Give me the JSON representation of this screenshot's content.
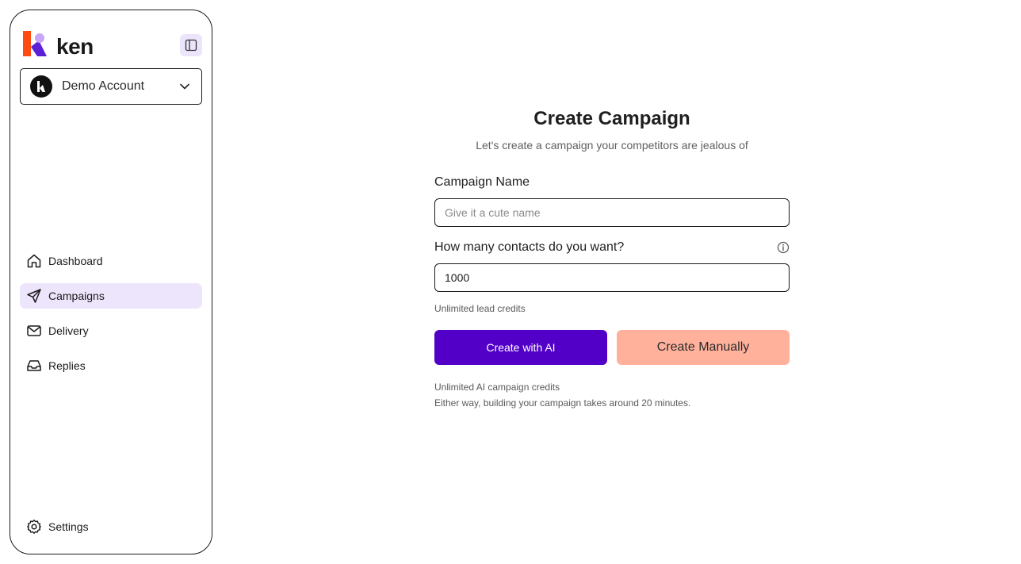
{
  "brand": {
    "name": "ken",
    "logo_icon": "ken-logo-icon"
  },
  "sidebar": {
    "collapse_icon": "sidebar-toggle-icon",
    "account": {
      "name": "Demo Account",
      "avatar_icon": "ken-avatar-icon",
      "chevron_icon": "chevron-down-icon"
    },
    "nav": [
      {
        "label": "Dashboard",
        "icon": "home-icon",
        "active": false
      },
      {
        "label": "Campaigns",
        "icon": "send-icon",
        "active": true
      },
      {
        "label": "Delivery",
        "icon": "mail-icon",
        "active": false
      },
      {
        "label": "Replies",
        "icon": "inbox-icon",
        "active": false
      }
    ],
    "settings": {
      "label": "Settings",
      "icon": "gear-icon"
    }
  },
  "main": {
    "title": "Create Campaign",
    "subtitle": "Let's create a campaign your competitors are jealous of",
    "campaign_name": {
      "label": "Campaign Name",
      "placeholder": "Give it a cute name",
      "value": ""
    },
    "contacts": {
      "label": "How many contacts do you want?",
      "value": "1000",
      "info_icon": "info-icon"
    },
    "lead_credits_hint": "Unlimited lead credits",
    "buttons": {
      "ai": "Create with AI",
      "manual": "Create Manually"
    },
    "footnote_1": "Unlimited AI campaign credits",
    "footnote_2": "Either way, building your campaign takes around 20 minutes."
  },
  "colors": {
    "accent": "#5200c8",
    "active_nav_bg": "#ede5fb",
    "manual_button_bg": "#ffb19c",
    "logo_orange": "#ff4a10",
    "logo_purple": "#5a1fd6",
    "logo_lilac": "#c9a6f5"
  }
}
